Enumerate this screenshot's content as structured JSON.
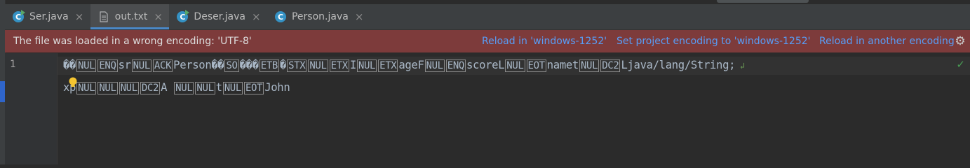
{
  "tabs": [
    {
      "label": "Ser.java",
      "icon": "java-run-class-icon",
      "active": false
    },
    {
      "label": "out.txt",
      "icon": "text-file-icon",
      "active": true
    },
    {
      "label": "Deser.java",
      "icon": "java-run-class-icon",
      "active": false
    },
    {
      "label": "Person.java",
      "icon": "java-class-icon",
      "active": false
    }
  ],
  "tab_close_glyph": "×",
  "banner": {
    "message": "The file was loaded in a wrong encoding: 'UTF-8'",
    "reload_link": "Reload in 'windows-1252'",
    "set_encoding_link": "Set project encoding to 'windows-1252'",
    "other_link": "Reload in another encoding"
  },
  "editor": {
    "line_number": "1",
    "line1_parts": [
      {
        "t": "r",
        "v": "��"
      },
      {
        "t": "c",
        "v": "NUL"
      },
      {
        "t": "c",
        "v": "ENQ"
      },
      {
        "t": "x",
        "v": "sr"
      },
      {
        "t": "c",
        "v": "NUL"
      },
      {
        "t": "c",
        "v": "ACK"
      },
      {
        "t": "x",
        "v": "Person"
      },
      {
        "t": "r",
        "v": "��"
      },
      {
        "t": "c",
        "v": "SO"
      },
      {
        "t": "r",
        "v": "���"
      },
      {
        "t": "c",
        "v": "ETB"
      },
      {
        "t": "r",
        "v": "�"
      },
      {
        "t": "c",
        "v": "STX"
      },
      {
        "t": "c",
        "v": "NUL"
      },
      {
        "t": "c",
        "v": "ETX"
      },
      {
        "t": "x",
        "v": "I"
      },
      {
        "t": "c",
        "v": "NUL"
      },
      {
        "t": "c",
        "v": "ETX"
      },
      {
        "t": "x",
        "v": "ageF"
      },
      {
        "t": "c",
        "v": "NUL"
      },
      {
        "t": "c",
        "v": "ENQ"
      },
      {
        "t": "x",
        "v": "scoreL"
      },
      {
        "t": "c",
        "v": "NUL"
      },
      {
        "t": "c",
        "v": "EOT"
      },
      {
        "t": "x",
        "v": "namet"
      },
      {
        "t": "c",
        "v": "NUL"
      },
      {
        "t": "c",
        "v": "DC2"
      },
      {
        "t": "x",
        "v": "Ljava/lang/String;"
      }
    ],
    "line2_parts": [
      {
        "t": "x",
        "v": "xp"
      },
      {
        "t": "c",
        "v": "NUL"
      },
      {
        "t": "c",
        "v": "NUL"
      },
      {
        "t": "c",
        "v": "NUL"
      },
      {
        "t": "c",
        "v": "DC2"
      },
      {
        "t": "x",
        "v": "A "
      },
      {
        "t": "c",
        "v": "NUL"
      },
      {
        "t": "c",
        "v": "NUL"
      },
      {
        "t": "x",
        "v": "t"
      },
      {
        "t": "c",
        "v": "NUL"
      },
      {
        "t": "c",
        "v": "EOT"
      },
      {
        "t": "x",
        "v": "John"
      }
    ]
  },
  "icons": {
    "settings": "gear-icon",
    "intention": "lightbulb-icon",
    "inspection_ok": "checkmark-icon",
    "soft_wrap": "soft-wrap-icon"
  },
  "colors": {
    "banner_bg": "#7d3b3b",
    "link": "#589df6",
    "active_tab_underline": "#4a88c7",
    "check": "#499c54"
  }
}
